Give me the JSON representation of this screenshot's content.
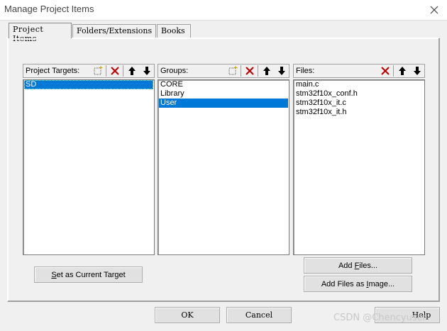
{
  "window": {
    "title": "Manage Project Items"
  },
  "tabs": [
    {
      "label": "Project Items",
      "active": true
    },
    {
      "label": "Folders/Extensions",
      "active": false
    },
    {
      "label": "Books",
      "active": false
    }
  ],
  "targets": {
    "label": "Project Targets:",
    "items": [
      "SD"
    ],
    "selected_index": 0
  },
  "groups": {
    "label": "Groups:",
    "items": [
      "CORE",
      "Library",
      "User"
    ],
    "selected_index": 2
  },
  "files": {
    "label": "Files:",
    "items": [
      "main.c",
      "stm32f10x_conf.h",
      "stm32f10x_it.c",
      "stm32f10x_it.h"
    ]
  },
  "buttons": {
    "set_current_underline": "S",
    "set_current_rest": "et as Current Target",
    "add_files_pre": "Add ",
    "add_files_underline": "F",
    "add_files_post": "iles...",
    "add_files_image_pre": "Add Files as ",
    "add_files_image_underline": "I",
    "add_files_image_post": "mage...",
    "ok": "OK",
    "cancel": "Cancel",
    "help": "Help"
  },
  "watermark": "CSDN @Chencyuser",
  "colors": {
    "selection": "#0078d7",
    "delete_red": "#c00000"
  }
}
